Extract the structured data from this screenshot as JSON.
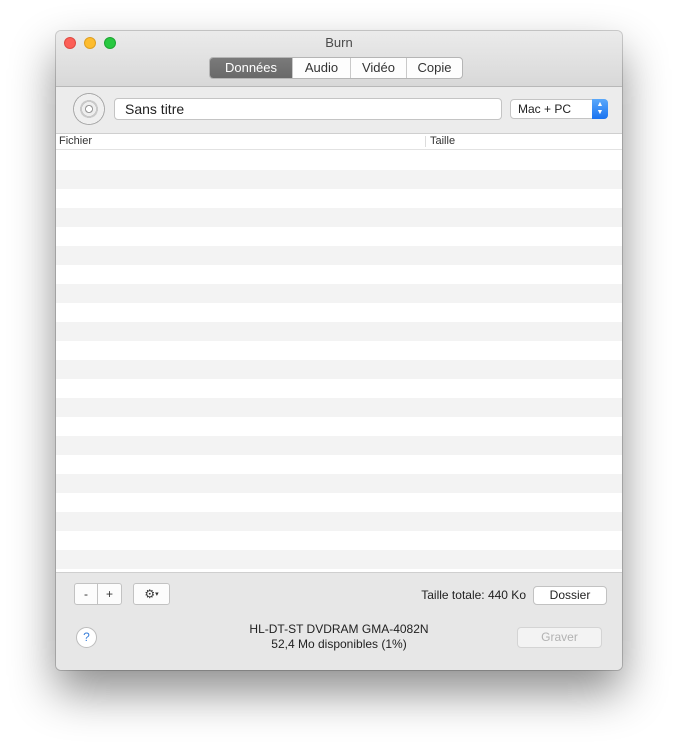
{
  "window": {
    "title": "Burn"
  },
  "tabs": [
    {
      "label": "Données",
      "active": true
    },
    {
      "label": "Audio",
      "active": false
    },
    {
      "label": "Vidéo",
      "active": false
    },
    {
      "label": "Copie",
      "active": false
    }
  ],
  "disc": {
    "icon": "cd-icon",
    "name_value": "Sans titre",
    "filesystem": {
      "selected": "Mac + PC"
    }
  },
  "table": {
    "columns": [
      "Fichier",
      "Taille"
    ],
    "rows": []
  },
  "toolbar": {
    "remove_label": "-",
    "add_label": "+",
    "gear_icon": "gear-icon",
    "gear_glyph": "⚙",
    "caret_glyph": "▾",
    "total_size": "Taille totale: 440 Ko",
    "folder_label": "Dossier"
  },
  "footer": {
    "help_label": "?",
    "drive_name": "HL-DT-ST DVDRAM GMA-4082N",
    "drive_space": "52,4 Mo disponibles (1%)",
    "burn_label": "Graver"
  },
  "colors": {
    "close": "#fc5f57",
    "minimize": "#fdbc2e",
    "zoom": "#28c840",
    "active_tab": "#6f6f6f",
    "select_accent": "#1a73f0"
  }
}
